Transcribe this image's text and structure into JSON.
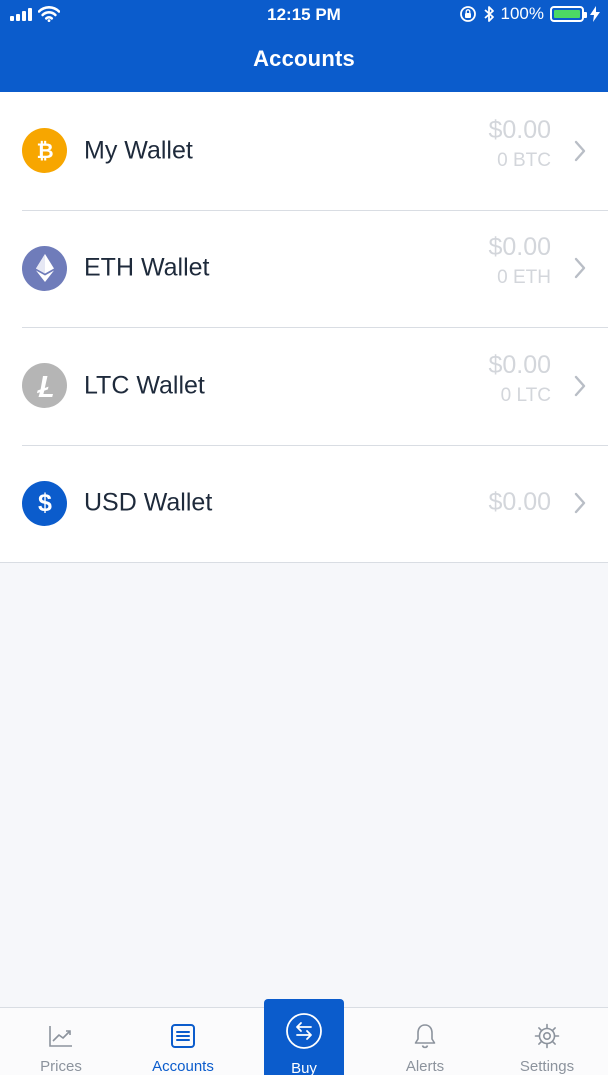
{
  "status_bar": {
    "time": "12:15 PM",
    "battery_label": "100%",
    "battery_level": 1.0,
    "battery_color": "#4cd964"
  },
  "header": {
    "title": "Accounts",
    "background": "#0b5ccc"
  },
  "wallets": [
    {
      "name": "My Wallet",
      "fiat": "$0.00",
      "crypto": "0 BTC",
      "icon": "bitcoin-icon",
      "color": "#f7a600"
    },
    {
      "name": "ETH Wallet",
      "fiat": "$0.00",
      "crypto": "0 ETH",
      "icon": "ethereum-icon",
      "color": "#6f7cba"
    },
    {
      "name": "LTC Wallet",
      "fiat": "$0.00",
      "crypto": "0 LTC",
      "icon": "litecoin-icon",
      "color": "#b5b5b5"
    },
    {
      "name": "USD Wallet",
      "fiat": "$0.00",
      "icon": "dollar-icon",
      "color": "#0b5ccc"
    }
  ],
  "tabbar": {
    "active": "Accounts",
    "items": [
      {
        "label": "Prices",
        "icon": "chart-icon"
      },
      {
        "label": "Accounts",
        "icon": "accounts-list-icon"
      },
      {
        "label": "Buy",
        "icon": "exchange-arrows-icon"
      },
      {
        "label": "Alerts",
        "icon": "bell-icon"
      },
      {
        "label": "Settings",
        "icon": "gear-icon"
      }
    ]
  }
}
